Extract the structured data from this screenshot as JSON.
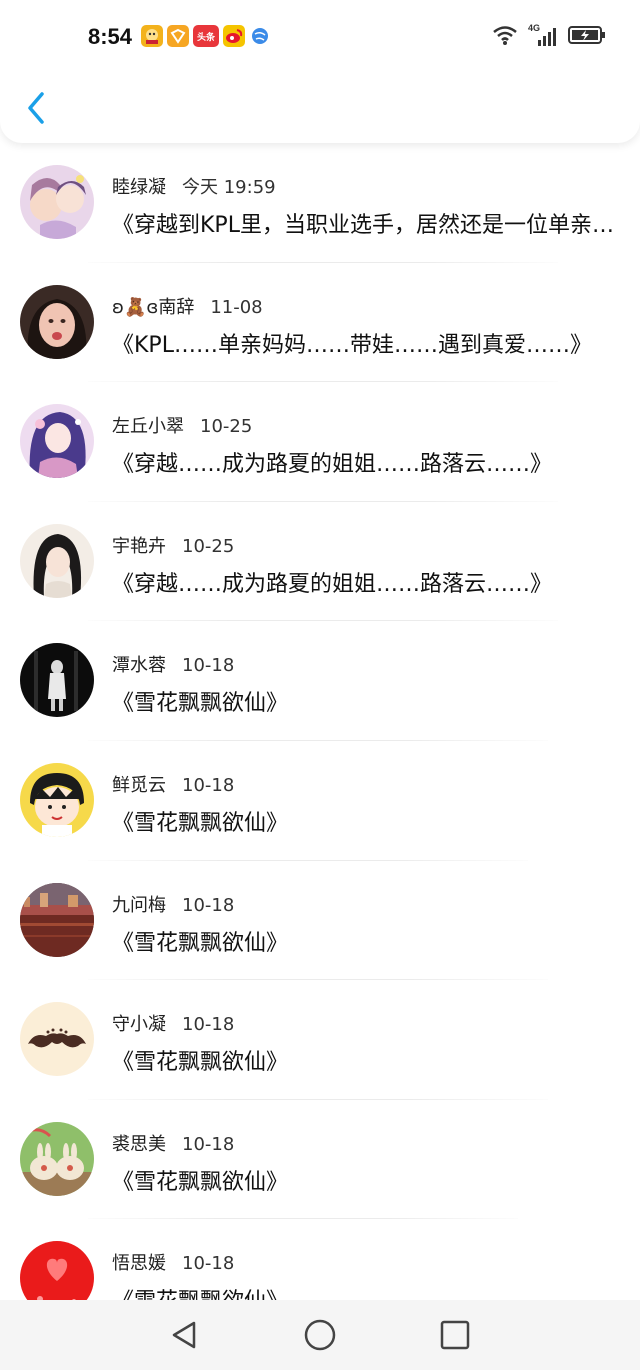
{
  "status_bar": {
    "time": "8:54",
    "notification_icons": [
      "game-app-icon",
      "shield-app-icon",
      "toutiao-app-icon",
      "weibo-app-icon",
      "globe-app-icon"
    ],
    "toutiao_label": "头条",
    "network_label": "4G"
  },
  "header": {
    "back_icon": "chevron-left-icon",
    "accent_color": "#1aa0e8"
  },
  "items": [
    {
      "name": "睦绿凝",
      "date": "今天 19:59",
      "title": "《穿越到KPL里，当职业选手，居然还是一位单亲妈妈》"
    },
    {
      "name": "ʚ🧸ɞ南辞",
      "date": "11-08",
      "title": "《KPL……单亲妈妈……带娃……遇到真爱……》"
    },
    {
      "name": "左丘小翠",
      "date": "10-25",
      "title": "《穿越……成为路夏的姐姐……路落云……》"
    },
    {
      "name": "宇艳卉",
      "date": "10-25",
      "title": "《穿越……成为路夏的姐姐……路落云……》"
    },
    {
      "name": "潭水蓉",
      "date": "10-18",
      "title": "《雪花飘飘欲仙》"
    },
    {
      "name": "鲜觅云",
      "date": "10-18",
      "title": "《雪花飘飘欲仙》"
    },
    {
      "name": "九问梅",
      "date": "10-18",
      "title": "《雪花飘飘欲仙》"
    },
    {
      "name": "守小凝",
      "date": "10-18",
      "title": "《雪花飘飘欲仙》"
    },
    {
      "name": "裘思美",
      "date": "10-18",
      "title": "《雪花飘飘欲仙》"
    },
    {
      "name": "悟思媛",
      "date": "10-18",
      "title": "《雪花飘飘欲仙》"
    }
  ],
  "nav_bar": {
    "icons": [
      "back-triangle-icon",
      "home-circle-icon",
      "recents-square-icon"
    ]
  }
}
